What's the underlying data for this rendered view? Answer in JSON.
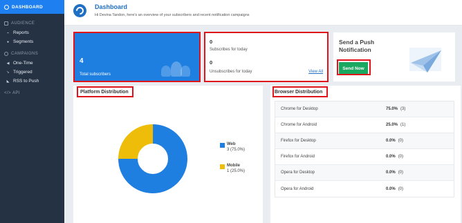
{
  "sidebar": {
    "active": "DASHBOARD",
    "sections": [
      {
        "label": "AUDIENCE",
        "items": [
          "Reports",
          "Segments"
        ]
      },
      {
        "label": "CAMPAIGNS",
        "items": [
          "One-Time",
          "Triggered",
          "RSS to Push"
        ]
      },
      {
        "label": "API",
        "items": []
      }
    ]
  },
  "header": {
    "title": "Dashboard",
    "subtitle": "Hi Devina Tandon, here's an overview of your subscribers and recent notification campaigns"
  },
  "total": {
    "value": "4",
    "label": "Total subscribers"
  },
  "subs": {
    "today_value": "0",
    "today_label": "Subscribes for today",
    "unsub_value": "0",
    "unsub_label": "Unsubscribes for today",
    "view_all": "View All"
  },
  "push": {
    "title": "Send a Push Notification",
    "button": "Send Now"
  },
  "platform": {
    "title": "Platform Distribution",
    "items": [
      {
        "name": "Web",
        "detail": "3 (75.0%)",
        "fraction": 0.75,
        "color": "#1f7fe1"
      },
      {
        "name": "Mobile",
        "detail": "1 (25.0%)",
        "fraction": 0.25,
        "color": "#eebd09"
      }
    ]
  },
  "browser": {
    "title": "Browser Distribution",
    "rows": [
      {
        "name": "Chrome for Desktop",
        "pct": "75.0%",
        "count": "(3)"
      },
      {
        "name": "Chrome for Android",
        "pct": "25.0%",
        "count": "(1)"
      },
      {
        "name": "Firefox for Desktop",
        "pct": "0.0%",
        "count": "(0)"
      },
      {
        "name": "Firefox for Android",
        "pct": "0.0%",
        "count": "(0)"
      },
      {
        "name": "Opera for Desktop",
        "pct": "0.0%",
        "count": "(0)"
      },
      {
        "name": "Opera for Android",
        "pct": "0.0%",
        "count": "(0)"
      }
    ]
  },
  "colors": {
    "accent": "#1f7fe1",
    "sidebar": "#253243",
    "success": "#1aa75f",
    "highlight": "#e0131b"
  },
  "icons": [
    "dashboard-icon",
    "audience-icon",
    "reports-icon",
    "segments-icon",
    "campaigns-icon",
    "one-time-icon",
    "triggered-icon",
    "rss-icon",
    "api-icon",
    "logo-icon",
    "subscribers-icon",
    "paper-plane-icon"
  ]
}
